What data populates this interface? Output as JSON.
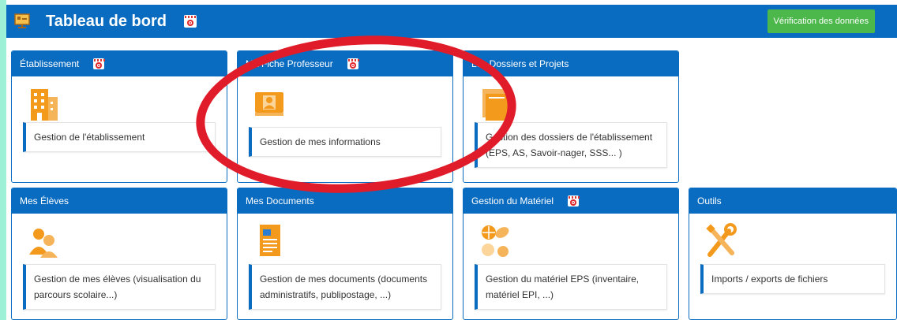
{
  "header": {
    "title": "Tableau de bord",
    "verify_button": "Vérification des données"
  },
  "colors": {
    "primary": "#0a6cc0",
    "success": "#4cb84b",
    "icon_orange": "#f39a1d",
    "annotation_red": "#e11c2a"
  },
  "cards": [
    {
      "title": "Établissement",
      "description": "Gestion de l'établissement",
      "icon": "building-icon"
    },
    {
      "title": "Ma Fiche Professeur",
      "description": "Gestion de mes informations",
      "icon": "id-card-icon"
    },
    {
      "title": "Les Dossiers et Projets",
      "description": "Gestion des dossiers de l'établissement (EPS, AS, Savoir-nager, SSS... )",
      "icon": "folders-icon"
    },
    {
      "title": "Mes Élèves",
      "description": "Gestion de mes élèves (visualisation du parcours scolaire...)",
      "icon": "users-icon"
    },
    {
      "title": "Mes Documents",
      "description": "Gestion de mes documents (documents administratifs, publipostage, ...)",
      "icon": "document-icon"
    },
    {
      "title": "Gestion du Matériel",
      "description": "Gestion du matériel EPS (inventaire, matériel EPI, ...)",
      "icon": "sports-equipment-icon"
    },
    {
      "title": "Outils",
      "description": "Imports / exports de fichiers",
      "icon": "tools-icon"
    }
  ]
}
